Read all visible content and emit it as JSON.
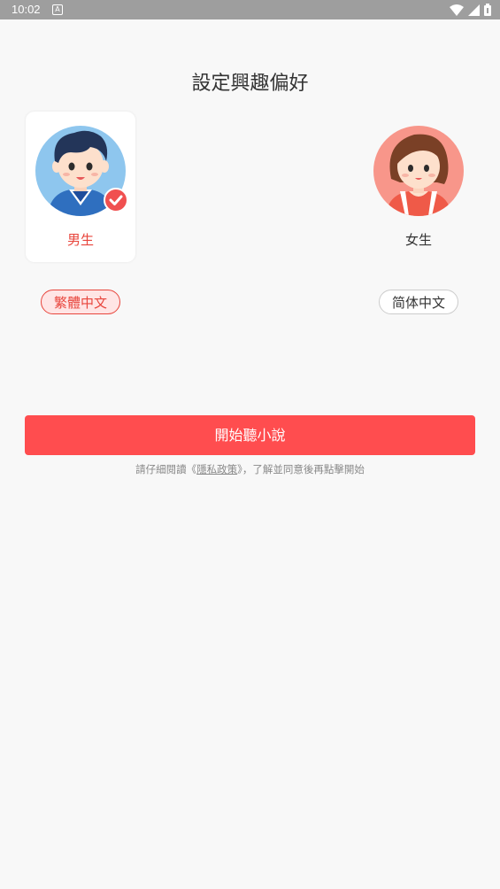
{
  "status_bar": {
    "time": "10:02",
    "icon_letter": "A"
  },
  "title": "設定興趣偏好",
  "genders": [
    {
      "label": "男生",
      "selected": true
    },
    {
      "label": "女生",
      "selected": false
    }
  ],
  "languages": [
    {
      "label": "繁體中文",
      "selected": true
    },
    {
      "label": "简体中文",
      "selected": false
    }
  ],
  "cta": {
    "label": "開始聽小說"
  },
  "notice": {
    "prefix": "請仔細閱讀《",
    "link": "隱私政策",
    "suffix": "》，了解並同意後再點擊開始"
  },
  "colors": {
    "accent": "#ff4d4f",
    "accent_text": "#e8453c",
    "selected_chip_bg": "#ffe5e5",
    "unselected_chip_border": "#cccccc",
    "text_dark": "#333333",
    "boy_bg": "#8ec6ee",
    "girl_bg": "#f8968a"
  }
}
